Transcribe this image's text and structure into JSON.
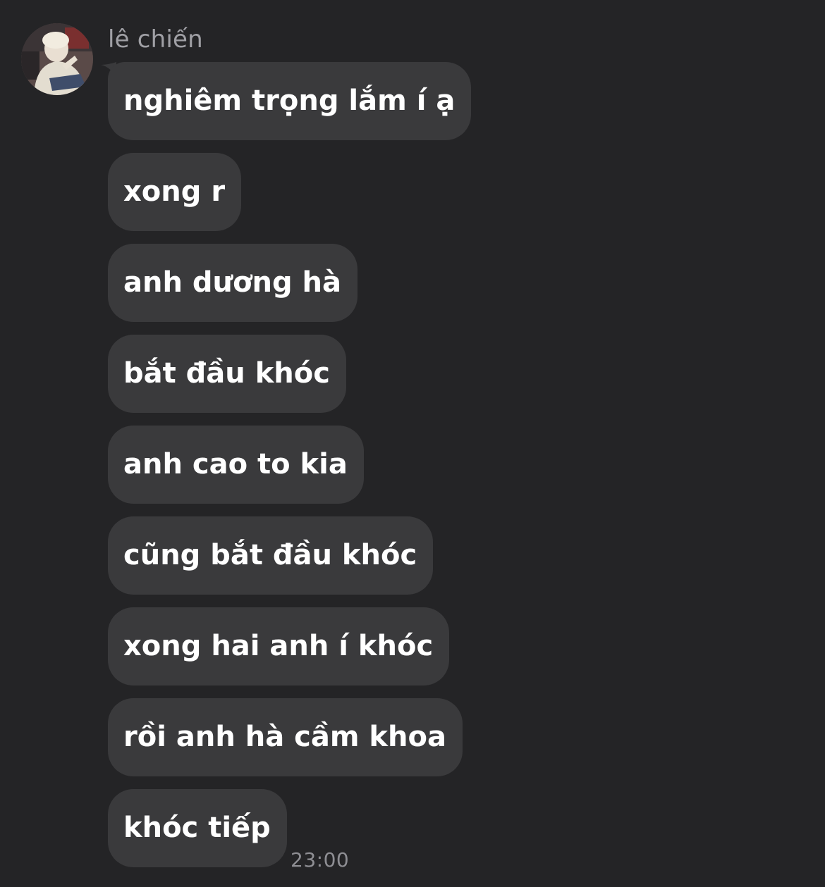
{
  "conversation": {
    "sender_name": "lê chiến",
    "avatar_icon": "user-avatar",
    "bubble_color": "#3a3a3c",
    "background_color": "#242426",
    "messages": [
      {
        "text": "nghiêm trọng lắm í ạ"
      },
      {
        "text": "xong r"
      },
      {
        "text": "anh dương hà"
      },
      {
        "text": "bắt đầu khóc"
      },
      {
        "text": "anh cao to kia"
      },
      {
        "text": "cũng bắt đầu khóc"
      },
      {
        "text": "xong hai anh í khóc"
      },
      {
        "text": "rồi anh hà cầm khoa"
      },
      {
        "text": "khóc tiếp"
      }
    ],
    "timestamp": "23:00"
  }
}
